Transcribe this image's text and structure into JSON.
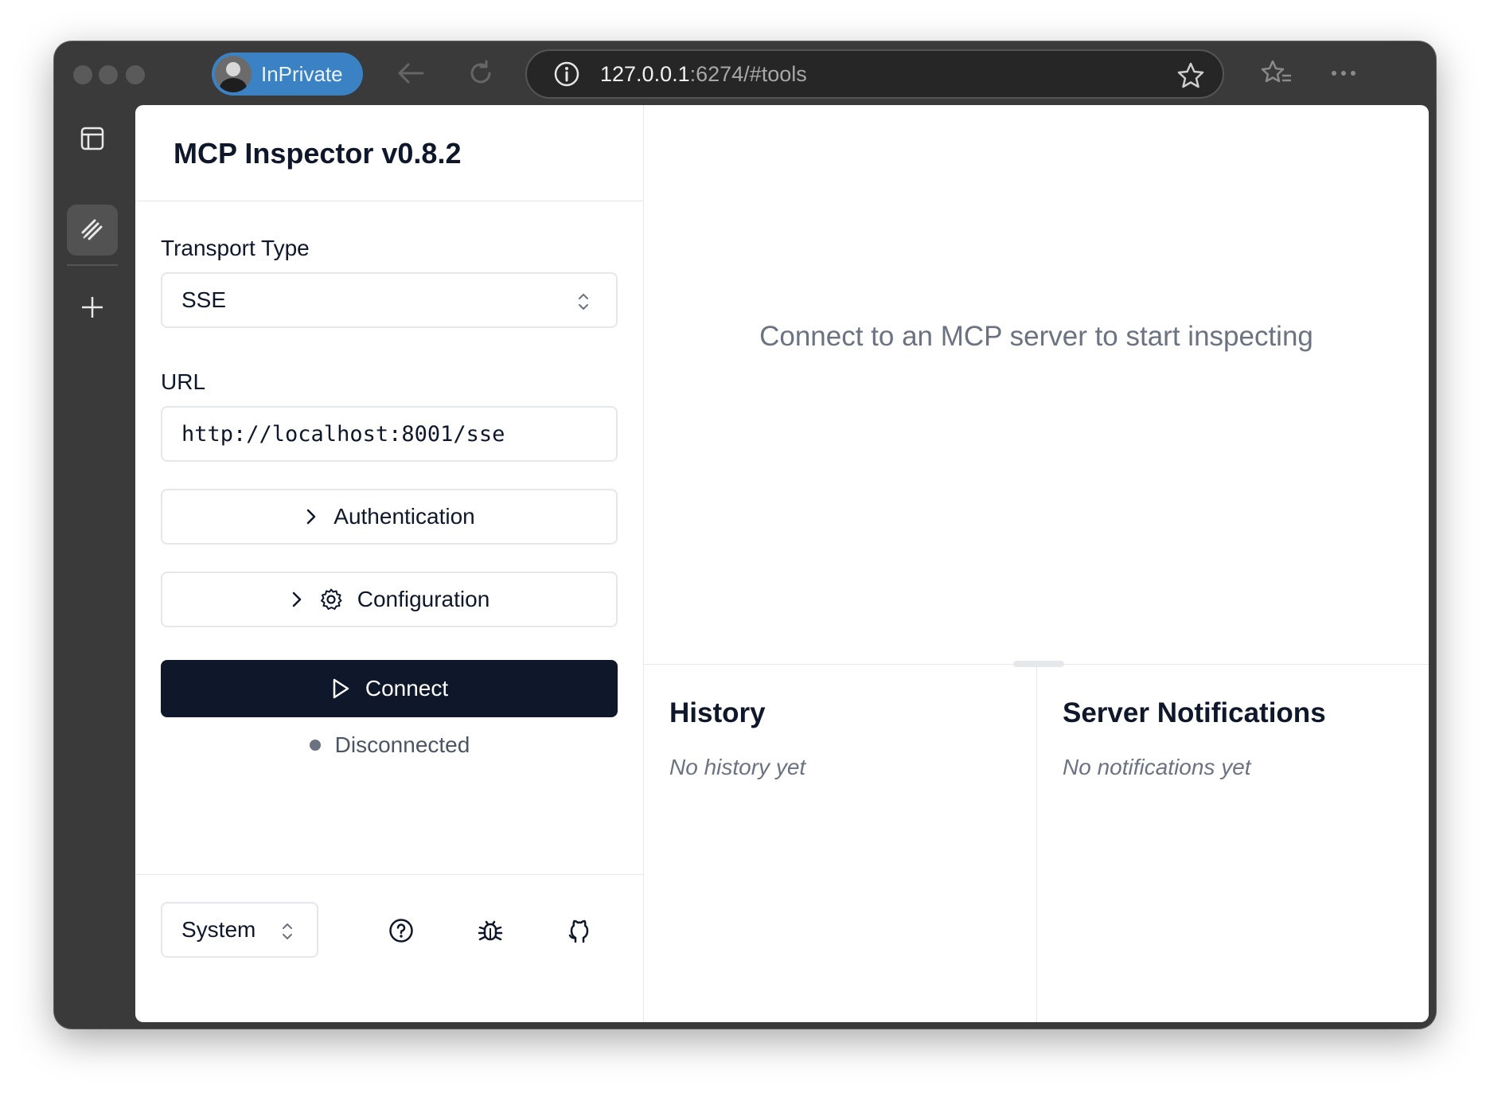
{
  "browser": {
    "profile_label": "InPrivate",
    "address_host": "127.0.0.1",
    "address_rest": ":6274/#tools"
  },
  "sidebar": {
    "title": "MCP Inspector v0.8.2",
    "transport_label": "Transport Type",
    "transport_value": "SSE",
    "url_label": "URL",
    "url_value": "http://localhost:8001/sse",
    "auth_label": "Authentication",
    "config_label": "Configuration",
    "connect_label": "Connect",
    "status_text": "Disconnected",
    "theme_value": "System"
  },
  "main": {
    "empty_message": "Connect to an MCP server to start inspecting",
    "history_title": "History",
    "history_empty": "No history yet",
    "notifications_title": "Server Notifications",
    "notifications_empty": "No notifications yet"
  },
  "colors": {
    "primary": "#0f172a",
    "muted": "#6b7280",
    "border": "#e5e7eb",
    "profile_pill": "#3b82c4"
  },
  "icons": {
    "rail": [
      "sidebar-panel-icon",
      "mcp-logo-icon",
      "plus-icon"
    ],
    "footer": [
      "help-icon",
      "bug-icon",
      "github-icon"
    ]
  }
}
